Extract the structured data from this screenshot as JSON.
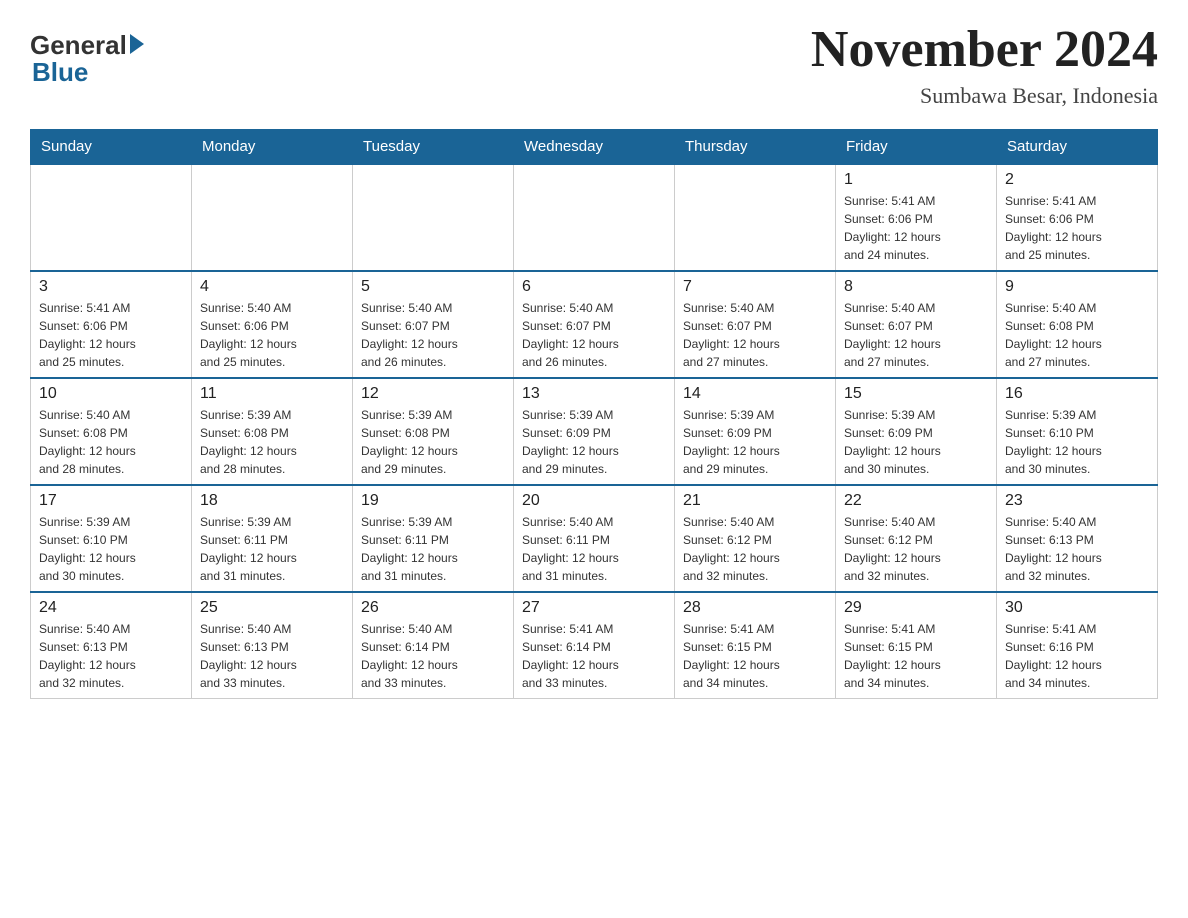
{
  "header": {
    "logo_general": "General",
    "logo_blue": "Blue",
    "month_title": "November 2024",
    "location": "Sumbawa Besar, Indonesia"
  },
  "days_of_week": [
    "Sunday",
    "Monday",
    "Tuesday",
    "Wednesday",
    "Thursday",
    "Friday",
    "Saturday"
  ],
  "weeks": [
    [
      {
        "day": "",
        "info": ""
      },
      {
        "day": "",
        "info": ""
      },
      {
        "day": "",
        "info": ""
      },
      {
        "day": "",
        "info": ""
      },
      {
        "day": "",
        "info": ""
      },
      {
        "day": "1",
        "info": "Sunrise: 5:41 AM\nSunset: 6:06 PM\nDaylight: 12 hours\nand 24 minutes."
      },
      {
        "day": "2",
        "info": "Sunrise: 5:41 AM\nSunset: 6:06 PM\nDaylight: 12 hours\nand 25 minutes."
      }
    ],
    [
      {
        "day": "3",
        "info": "Sunrise: 5:41 AM\nSunset: 6:06 PM\nDaylight: 12 hours\nand 25 minutes."
      },
      {
        "day": "4",
        "info": "Sunrise: 5:40 AM\nSunset: 6:06 PM\nDaylight: 12 hours\nand 25 minutes."
      },
      {
        "day": "5",
        "info": "Sunrise: 5:40 AM\nSunset: 6:07 PM\nDaylight: 12 hours\nand 26 minutes."
      },
      {
        "day": "6",
        "info": "Sunrise: 5:40 AM\nSunset: 6:07 PM\nDaylight: 12 hours\nand 26 minutes."
      },
      {
        "day": "7",
        "info": "Sunrise: 5:40 AM\nSunset: 6:07 PM\nDaylight: 12 hours\nand 27 minutes."
      },
      {
        "day": "8",
        "info": "Sunrise: 5:40 AM\nSunset: 6:07 PM\nDaylight: 12 hours\nand 27 minutes."
      },
      {
        "day": "9",
        "info": "Sunrise: 5:40 AM\nSunset: 6:08 PM\nDaylight: 12 hours\nand 27 minutes."
      }
    ],
    [
      {
        "day": "10",
        "info": "Sunrise: 5:40 AM\nSunset: 6:08 PM\nDaylight: 12 hours\nand 28 minutes."
      },
      {
        "day": "11",
        "info": "Sunrise: 5:39 AM\nSunset: 6:08 PM\nDaylight: 12 hours\nand 28 minutes."
      },
      {
        "day": "12",
        "info": "Sunrise: 5:39 AM\nSunset: 6:08 PM\nDaylight: 12 hours\nand 29 minutes."
      },
      {
        "day": "13",
        "info": "Sunrise: 5:39 AM\nSunset: 6:09 PM\nDaylight: 12 hours\nand 29 minutes."
      },
      {
        "day": "14",
        "info": "Sunrise: 5:39 AM\nSunset: 6:09 PM\nDaylight: 12 hours\nand 29 minutes."
      },
      {
        "day": "15",
        "info": "Sunrise: 5:39 AM\nSunset: 6:09 PM\nDaylight: 12 hours\nand 30 minutes."
      },
      {
        "day": "16",
        "info": "Sunrise: 5:39 AM\nSunset: 6:10 PM\nDaylight: 12 hours\nand 30 minutes."
      }
    ],
    [
      {
        "day": "17",
        "info": "Sunrise: 5:39 AM\nSunset: 6:10 PM\nDaylight: 12 hours\nand 30 minutes."
      },
      {
        "day": "18",
        "info": "Sunrise: 5:39 AM\nSunset: 6:11 PM\nDaylight: 12 hours\nand 31 minutes."
      },
      {
        "day": "19",
        "info": "Sunrise: 5:39 AM\nSunset: 6:11 PM\nDaylight: 12 hours\nand 31 minutes."
      },
      {
        "day": "20",
        "info": "Sunrise: 5:40 AM\nSunset: 6:11 PM\nDaylight: 12 hours\nand 31 minutes."
      },
      {
        "day": "21",
        "info": "Sunrise: 5:40 AM\nSunset: 6:12 PM\nDaylight: 12 hours\nand 32 minutes."
      },
      {
        "day": "22",
        "info": "Sunrise: 5:40 AM\nSunset: 6:12 PM\nDaylight: 12 hours\nand 32 minutes."
      },
      {
        "day": "23",
        "info": "Sunrise: 5:40 AM\nSunset: 6:13 PM\nDaylight: 12 hours\nand 32 minutes."
      }
    ],
    [
      {
        "day": "24",
        "info": "Sunrise: 5:40 AM\nSunset: 6:13 PM\nDaylight: 12 hours\nand 32 minutes."
      },
      {
        "day": "25",
        "info": "Sunrise: 5:40 AM\nSunset: 6:13 PM\nDaylight: 12 hours\nand 33 minutes."
      },
      {
        "day": "26",
        "info": "Sunrise: 5:40 AM\nSunset: 6:14 PM\nDaylight: 12 hours\nand 33 minutes."
      },
      {
        "day": "27",
        "info": "Sunrise: 5:41 AM\nSunset: 6:14 PM\nDaylight: 12 hours\nand 33 minutes."
      },
      {
        "day": "28",
        "info": "Sunrise: 5:41 AM\nSunset: 6:15 PM\nDaylight: 12 hours\nand 34 minutes."
      },
      {
        "day": "29",
        "info": "Sunrise: 5:41 AM\nSunset: 6:15 PM\nDaylight: 12 hours\nand 34 minutes."
      },
      {
        "day": "30",
        "info": "Sunrise: 5:41 AM\nSunset: 6:16 PM\nDaylight: 12 hours\nand 34 minutes."
      }
    ]
  ]
}
